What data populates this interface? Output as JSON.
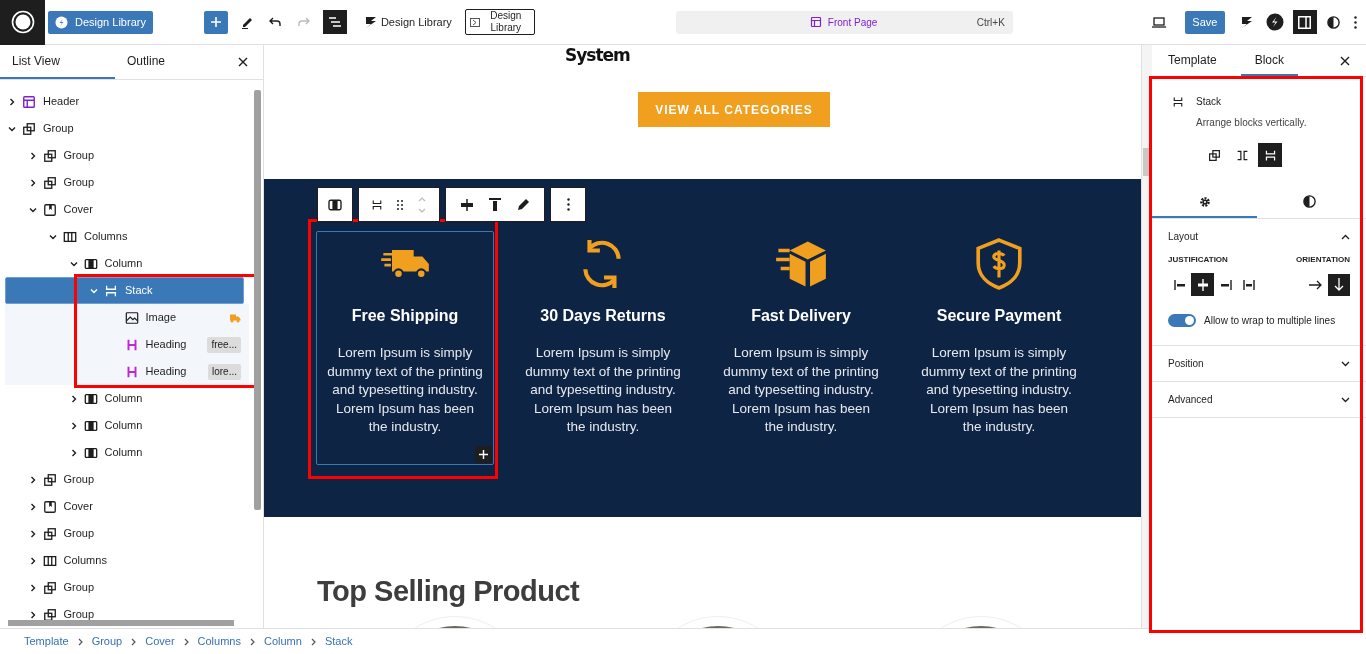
{
  "topbar": {
    "site_button": "Design Library",
    "library_link": "Design Library",
    "library_button": "Design Library",
    "command": {
      "label": "Front Page",
      "shortcut": "Ctrl+K"
    },
    "save": "Save"
  },
  "list_panel": {
    "tabs": [
      {
        "label": "List View",
        "selected": true
      },
      {
        "label": "Outline",
        "selected": false
      }
    ],
    "tree": [
      {
        "label": "Header",
        "kind": "template-part",
        "expanded": false,
        "selected": false
      },
      {
        "label": "Group",
        "kind": "group",
        "expanded": true,
        "selected": false,
        "children": [
          {
            "label": "Group",
            "kind": "group",
            "expanded": false,
            "selected": false
          },
          {
            "label": "Group",
            "kind": "group",
            "expanded": false,
            "selected": false
          },
          {
            "label": "Cover",
            "kind": "cover",
            "expanded": true,
            "selected": false,
            "children": [
              {
                "label": "Columns",
                "kind": "columns",
                "expanded": true,
                "selected": false,
                "children": [
                  {
                    "label": "Column",
                    "kind": "column",
                    "expanded": true,
                    "selected": false,
                    "children": [
                      {
                        "label": "Stack",
                        "kind": "stack",
                        "expanded": true,
                        "selected": true,
                        "highlighted": true,
                        "children": [
                          {
                            "label": "Image",
                            "kind": "image",
                            "selected": false
                          },
                          {
                            "label": "Heading",
                            "kind": "heading",
                            "selected": false,
                            "badge": "free..."
                          },
                          {
                            "label": "Heading",
                            "kind": "heading",
                            "selected": false,
                            "badge": "lore..."
                          }
                        ]
                      }
                    ]
                  },
                  {
                    "label": "Column",
                    "kind": "column",
                    "expanded": false,
                    "selected": false
                  },
                  {
                    "label": "Column",
                    "kind": "column",
                    "expanded": false,
                    "selected": false
                  },
                  {
                    "label": "Column",
                    "kind": "column",
                    "expanded": false,
                    "selected": false
                  }
                ]
              }
            ]
          },
          {
            "label": "Group",
            "kind": "group",
            "expanded": false,
            "selected": false
          },
          {
            "label": "Cover",
            "kind": "cover",
            "expanded": false,
            "selected": false
          },
          {
            "label": "Group",
            "kind": "group",
            "expanded": false,
            "selected": false
          },
          {
            "label": "Columns",
            "kind": "columns",
            "expanded": false,
            "selected": false
          },
          {
            "label": "Group",
            "kind": "group",
            "expanded": false,
            "selected": false
          },
          {
            "label": "Group",
            "kind": "group",
            "expanded": false,
            "selected": false
          }
        ]
      }
    ]
  },
  "canvas": {
    "section_heading": "System",
    "categories_button": "VIEW ALL CATEGORIES",
    "features": [
      {
        "kind": "truck",
        "title": "Free Shipping",
        "text": "Lorem Ipsum is simply dummy text of the printing and typesetting industry. Lorem Ipsum has been the industry.",
        "selected": true,
        "highlighted": true
      },
      {
        "kind": "refresh",
        "title": "30 Days Returns",
        "text": "Lorem Ipsum is simply dummy text of the printing and typesetting industry. Lorem Ipsum has been the industry.",
        "selected": false,
        "highlighted": false
      },
      {
        "kind": "box",
        "title": "Fast Delivery",
        "text": "Lorem Ipsum is simply dummy text of the printing and typesetting industry. Lorem Ipsum has been the industry.",
        "selected": false,
        "highlighted": false
      },
      {
        "kind": "shield",
        "title": "Secure Payment",
        "text": "Lorem Ipsum is simply dummy text of the printing and typesetting industry. Lorem Ipsum has been the industry.",
        "selected": false,
        "highlighted": false
      }
    ],
    "products_heading": "Top Selling Product"
  },
  "breadcrumb": [
    "Template",
    "Group",
    "Cover",
    "Columns",
    "Column",
    "Stack"
  ],
  "inspector": {
    "tabs": [
      {
        "label": "Template",
        "selected": false
      },
      {
        "label": "Block",
        "selected": true
      }
    ],
    "highlighted": true,
    "block": {
      "name": "Stack",
      "description": "Arrange blocks vertically."
    },
    "variations": [
      {
        "kind": "group",
        "selected": false
      },
      {
        "kind": "row",
        "selected": false
      },
      {
        "kind": "stack",
        "selected": true
      }
    ],
    "settings_tabs": [
      {
        "kind": "settings",
        "selected": true
      },
      {
        "kind": "styles",
        "selected": false
      }
    ],
    "sections": [
      {
        "label": "Layout",
        "expanded": true
      },
      {
        "label": "Position",
        "expanded": false
      },
      {
        "label": "Advanced",
        "expanded": false
      }
    ],
    "layout": {
      "justification_label": "JUSTIFICATION",
      "orientation_label": "ORIENTATION",
      "justification": [
        {
          "kind": "left",
          "selected": false
        },
        {
          "kind": "center",
          "selected": true
        },
        {
          "kind": "right",
          "selected": false
        },
        {
          "kind": "space-between",
          "selected": false
        }
      ],
      "orientation": [
        {
          "kind": "horizontal",
          "selected": false
        },
        {
          "kind": "vertical",
          "selected": true
        }
      ],
      "wrap": {
        "label": "Allow to wrap to multiple lines",
        "on": true
      }
    }
  }
}
